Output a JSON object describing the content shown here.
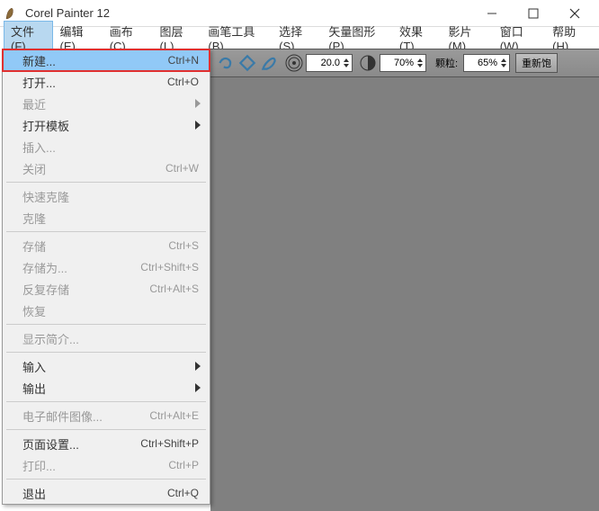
{
  "title": "Corel Painter 12",
  "menubar": {
    "file": "文件(F)",
    "edit": "编辑(E)",
    "canvas": "画布(C)",
    "layer": "图层(L)",
    "brush": "画笔工具(B)",
    "select": "选择(S)",
    "shapes": "矢量图形(P)",
    "effects": "效果(T)",
    "movie": "影片(M)",
    "window": "窗口(W)",
    "help": "帮助(H)"
  },
  "toolbar": {
    "size_value": "20.0",
    "opacity_value": "70%",
    "grain_label": "颗粒:",
    "grain_value": "65%",
    "resat_btn": "重新饱"
  },
  "dropdown": {
    "new": {
      "label": "新建...",
      "shortcut": "Ctrl+N"
    },
    "open": {
      "label": "打开...",
      "shortcut": "Ctrl+O"
    },
    "recent": {
      "label": "最近"
    },
    "open_template": {
      "label": "打开模板"
    },
    "insert": {
      "label": "插入..."
    },
    "close": {
      "label": "关闭",
      "shortcut": "Ctrl+W"
    },
    "quick_clone": {
      "label": "快速克隆"
    },
    "clone": {
      "label": "克隆"
    },
    "save": {
      "label": "存储",
      "shortcut": "Ctrl+S"
    },
    "save_as": {
      "label": "存储为...",
      "shortcut": "Ctrl+Shift+S"
    },
    "iterative_save": {
      "label": "反复存储",
      "shortcut": "Ctrl+Alt+S"
    },
    "revert": {
      "label": "恢复"
    },
    "show_intro": {
      "label": "显示简介..."
    },
    "import": {
      "label": "输入"
    },
    "export": {
      "label": "输出"
    },
    "email": {
      "label": "电子邮件图像...",
      "shortcut": "Ctrl+Alt+E"
    },
    "page_setup": {
      "label": "页面设置...",
      "shortcut": "Ctrl+Shift+P"
    },
    "print": {
      "label": "打印...",
      "shortcut": "Ctrl+P"
    },
    "quit": {
      "label": "退出",
      "shortcut": "Ctrl+Q"
    }
  }
}
